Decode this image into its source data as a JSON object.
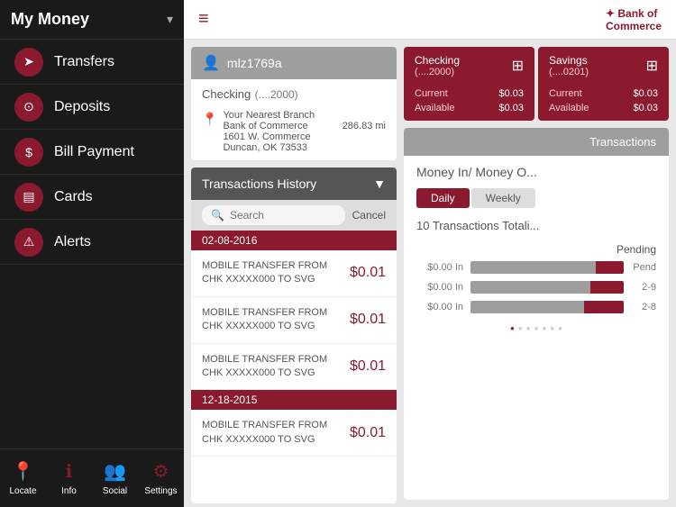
{
  "sidebar": {
    "title": "My Money",
    "chevron": "▾",
    "items": [
      {
        "id": "transfers",
        "label": "Transfers",
        "icon": "➤"
      },
      {
        "id": "deposits",
        "label": "Deposits",
        "icon": "📷"
      },
      {
        "id": "bill-payment",
        "label": "Bill Payment",
        "icon": "💳"
      },
      {
        "id": "cards",
        "label": "Cards",
        "icon": "☰"
      },
      {
        "id": "alerts",
        "label": "Alerts",
        "icon": "⚠"
      }
    ],
    "footer": [
      {
        "id": "locate",
        "label": "Locate",
        "icon": "📍"
      },
      {
        "id": "info",
        "label": "Info",
        "icon": "ℹ"
      },
      {
        "id": "social",
        "label": "Social",
        "icon": "👥"
      },
      {
        "id": "settings",
        "label": "Settings",
        "icon": "⚙"
      }
    ]
  },
  "header": {
    "hamburger": "≡",
    "bank_name": "Bank of Commerce",
    "bank_sub": "✦"
  },
  "account_card": {
    "username": "mlz1769a",
    "account_type": "Checking",
    "account_number": "(....2000)",
    "branch_name": "Your Nearest Branch",
    "bank_name": "Bank of Commerce",
    "address": "1601 W. Commerce",
    "city": "Duncan, OK 73533",
    "distance": "286.83 mi"
  },
  "checking_summary": {
    "name": "Checking",
    "number": "(....2000)",
    "current_label": "Current",
    "current_value": "$0.03",
    "available_label": "Available",
    "available_value": "$0.03"
  },
  "savings_summary": {
    "name": "Savings",
    "number": "(....0201)",
    "current_label": "Current",
    "current_value": "$0.03",
    "available_label": "Available",
    "available_value": "$0.03"
  },
  "transactions_list": {
    "title": "Transactions History",
    "filter_icon": "▼",
    "search_placeholder": "Search",
    "cancel_label": "Cancel",
    "dates": [
      {
        "date": "02-08-2016",
        "items": [
          {
            "desc": "MOBILE TRANSFER FROM CHK XXXXX000 TO SVG",
            "amount": "$0.01"
          },
          {
            "desc": "MOBILE TRANSFER FROM CHK XXXXX000 TO SVG",
            "amount": "$0.01"
          },
          {
            "desc": "MOBILE TRANSFER FROM CHK XXXXX000 TO SVG",
            "amount": "$0.01"
          }
        ]
      },
      {
        "date": "12-18-2015",
        "items": [
          {
            "desc": "MOBILE TRANSFER FROM CHK XXXXX000 TO SVG",
            "amount": "$0.01"
          }
        ]
      }
    ]
  },
  "chart": {
    "section_title": "Transactions",
    "subtitle": "Money In/ Money O...",
    "tabs": [
      {
        "label": "Daily",
        "active": true
      },
      {
        "label": "Weekly",
        "active": false
      }
    ],
    "total_label": "10 Transactions Totali...",
    "pending_label": "Pending",
    "bars": [
      {
        "label": "$0.00 In",
        "gray_pct": 85,
        "red_pct": 15,
        "date": "Pending"
      },
      {
        "label": "$0.00 In",
        "gray_pct": 80,
        "red_pct": 20,
        "date": "2-9"
      },
      {
        "label": "$0.00 In",
        "gray_pct": 75,
        "red_pct": 25,
        "date": "2-8"
      }
    ],
    "dots": [
      "●",
      "●",
      "●",
      "●",
      "●",
      "●",
      "●"
    ]
  },
  "colors": {
    "brand": "#8b1a2e",
    "sidebar_bg": "#1a1a1a",
    "gray_header": "#9e9e9e"
  }
}
